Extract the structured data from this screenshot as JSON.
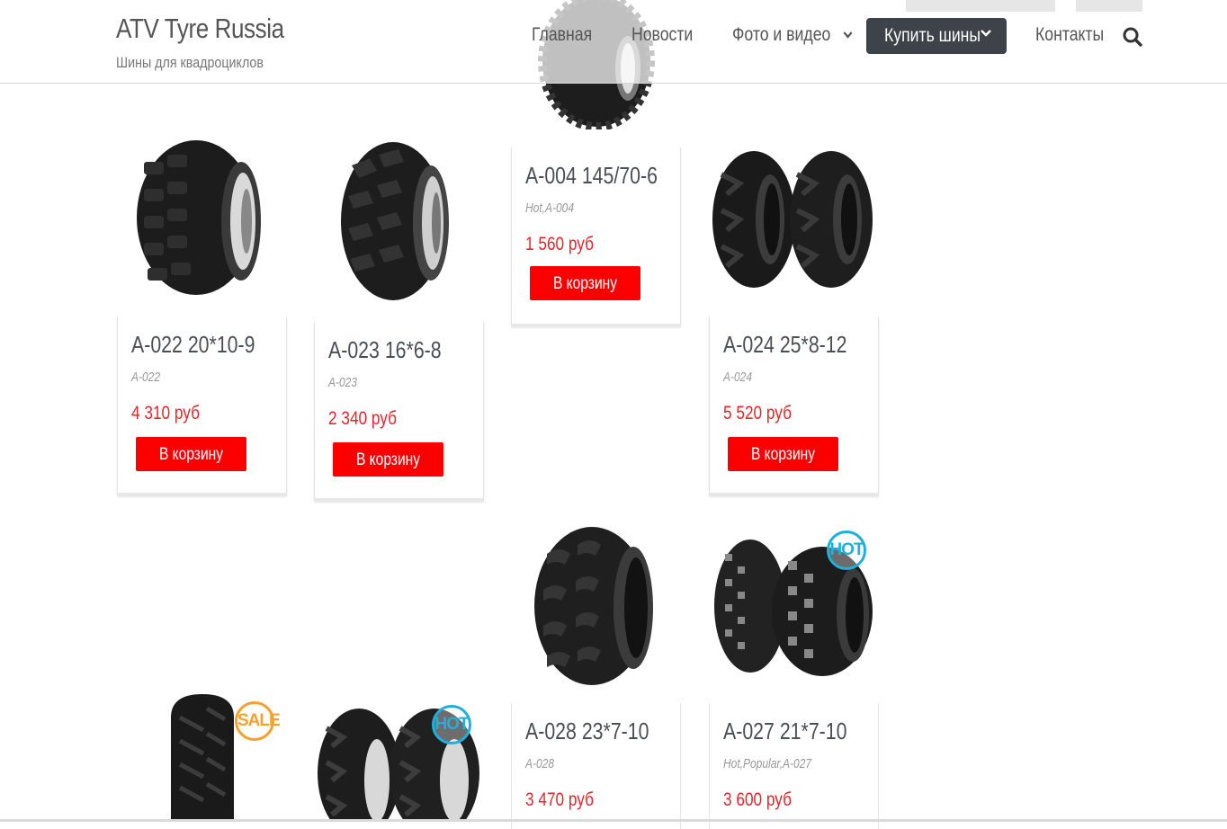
{
  "site": {
    "title": "ATV Tyre Russia",
    "tagline": "Шины для квадроциклов"
  },
  "nav": {
    "items": [
      {
        "label": "Главная"
      },
      {
        "label": "Новости"
      },
      {
        "label": "Фото и видео",
        "has_dropdown": true
      },
      {
        "label": "Купить шины",
        "has_dropdown": true,
        "active": true
      },
      {
        "label": "Контакты"
      }
    ],
    "search_icon": "search-icon"
  },
  "colors": {
    "price": "#e8242a",
    "cart_button": "#fa0000",
    "nav_active_bg": "#3e4249",
    "badge_sale": "#f5a12b",
    "badge_hot": "#1fb0dd"
  },
  "cart_label": "В корзину",
  "products": [
    {
      "name": "A-022 20*10-9",
      "tags": "A-022",
      "price": "4 310 руб",
      "button": "В корзину"
    },
    {
      "name": "A-023 16*6-8",
      "tags": "A-023",
      "price": "2 340 руб",
      "button": "В корзину"
    },
    {
      "name": "A-004 145/70-6",
      "tags": "Hot,A-004",
      "price": "1 560 руб",
      "button": "В корзину"
    },
    {
      "name": "A-024 25*8-12",
      "tags": "A-024",
      "price": "5 520 руб",
      "button": "В корзину"
    },
    {
      "name": "A-028 23*7-10",
      "tags": "A-028",
      "price": "3 470 руб"
    },
    {
      "name": "A-027 21*7-10",
      "tags": "Hot,Popular,A-027",
      "price": "3 600 руб",
      "badge": "HOT"
    }
  ],
  "partial_products": [
    {
      "badge": "SALE"
    },
    {
      "badge": "HOT"
    }
  ]
}
